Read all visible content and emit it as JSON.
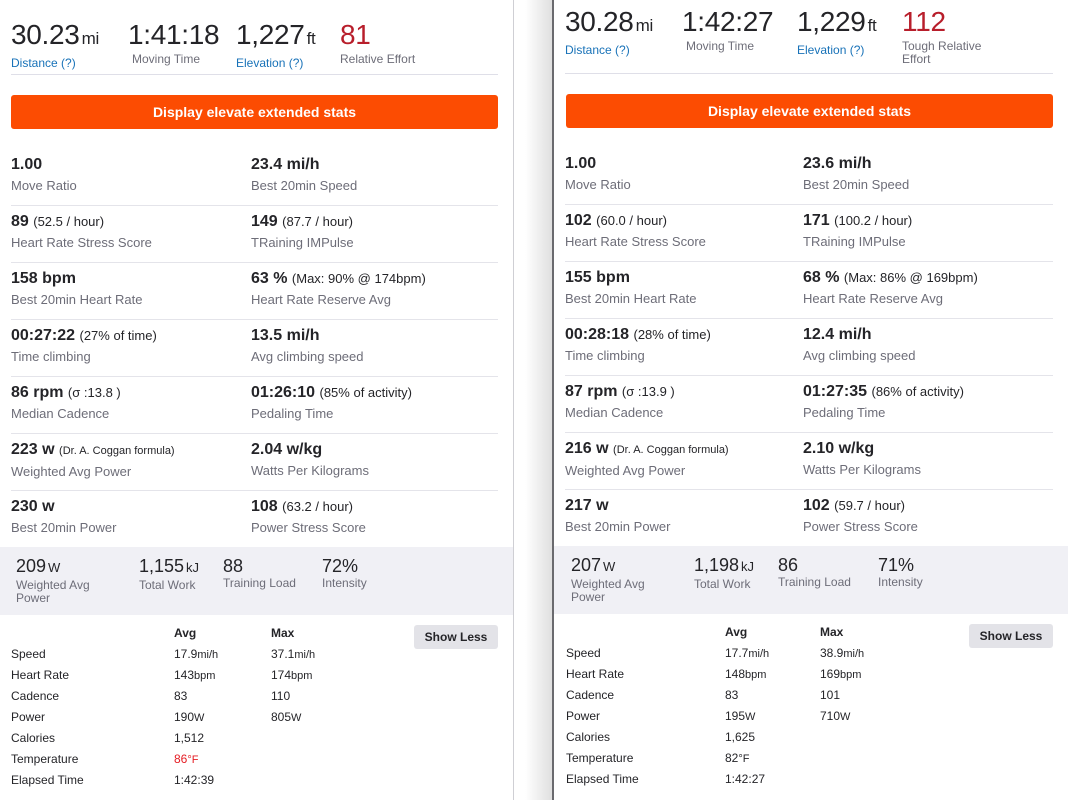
{
  "left": {
    "top_stats": [
      {
        "value": "30.23",
        "unit": "mi",
        "label": "Distance (?)",
        "link": true
      },
      {
        "value": "1:41:18",
        "unit": "",
        "label": "Moving Time",
        "link": false
      },
      {
        "value": "1,227",
        "unit": "ft",
        "label": "Elevation (?)",
        "link": true
      },
      {
        "value": "81",
        "unit": "",
        "label": "Relative Effort",
        "link": false
      }
    ],
    "elevate_button": "Display elevate extended stats",
    "grid": [
      [
        {
          "value": "1.00",
          "sub": "",
          "label": "Move Ratio"
        },
        {
          "value": "23.4 mi/h",
          "sub": "",
          "label": "Best 20min Speed"
        }
      ],
      [
        {
          "value": "89",
          "sub": "(52.5 / hour)",
          "label": "Heart Rate Stress Score"
        },
        {
          "value": "149",
          "sub": "(87.7 / hour)",
          "label": "TRaining IMPulse"
        }
      ],
      [
        {
          "value": "158 bpm",
          "sub": "",
          "label": "Best 20min Heart Rate"
        },
        {
          "value": "63 %",
          "sub": "(Max: 90% @ 174bpm)",
          "label": "Heart Rate Reserve Avg"
        }
      ],
      [
        {
          "value": "00:27:22",
          "sub": "(27% of time)",
          "label": "Time climbing"
        },
        {
          "value": "13.5 mi/h",
          "sub": "",
          "label": "Avg climbing speed"
        }
      ],
      [
        {
          "value": "86 rpm",
          "sub": "(σ :13.8 )",
          "label": "Median Cadence"
        },
        {
          "value": "01:26:10",
          "sub": "(85% of activity)",
          "label": "Pedaling Time"
        }
      ],
      [
        {
          "value": "223 w",
          "sub": "(Dr. A. Coggan formula)",
          "label": "Weighted Avg Power"
        },
        {
          "value": "2.04 w/kg",
          "sub": "",
          "label": "Watts Per Kilograms"
        }
      ],
      [
        {
          "value": "230 w",
          "sub": "",
          "label": "Best 20min Power"
        },
        {
          "value": "108",
          "sub": "(63.2 / hour)",
          "label": "Power Stress Score"
        }
      ]
    ],
    "power_band": [
      {
        "value": "209",
        "unit": "W",
        "label": "Weighted Avg Power"
      },
      {
        "value": "1,155",
        "unit": "kJ",
        "label": "Total Work"
      },
      {
        "value": "88",
        "unit": "",
        "label": "Training Load"
      },
      {
        "value": "72%",
        "unit": "",
        "label": "Intensity"
      }
    ],
    "show_less": "Show Less",
    "table": {
      "headers": {
        "avg": "Avg",
        "max": "Max"
      },
      "rows": [
        {
          "name": "Speed",
          "avg": "17.9",
          "avg_unit": "mi/h",
          "max": "37.1",
          "max_unit": "mi/h"
        },
        {
          "name": "Heart Rate",
          "avg": "143",
          "avg_unit": "bpm",
          "max": "174",
          "max_unit": "bpm"
        },
        {
          "name": "Cadence",
          "avg": "83",
          "avg_unit": "",
          "max": "110",
          "max_unit": ""
        },
        {
          "name": "Power",
          "avg": "190",
          "avg_unit": "W",
          "max": "805",
          "max_unit": "W"
        },
        {
          "name": "Calories",
          "avg": "1,512",
          "avg_unit": "",
          "max": "",
          "max_unit": ""
        },
        {
          "name": "Temperature",
          "avg": "86",
          "avg_unit": "°F",
          "max": "",
          "max_unit": ""
        },
        {
          "name": "Elapsed Time",
          "avg": "1:42:39",
          "avg_unit": "",
          "max": "",
          "max_unit": ""
        }
      ]
    }
  },
  "right": {
    "top_stats": [
      {
        "value": "30.28",
        "unit": "mi",
        "label": "Distance (?)",
        "link": true
      },
      {
        "value": "1:42:27",
        "unit": "",
        "label": "Moving Time",
        "link": false
      },
      {
        "value": "1,229",
        "unit": "ft",
        "label": "Elevation (?)",
        "link": true
      },
      {
        "value": "112",
        "unit": "",
        "label": "Tough Relative Effort",
        "link": false
      }
    ],
    "elevate_button": "Display elevate extended stats",
    "grid": [
      [
        {
          "value": "1.00",
          "sub": "",
          "label": "Move Ratio"
        },
        {
          "value": "23.6 mi/h",
          "sub": "",
          "label": "Best 20min Speed"
        }
      ],
      [
        {
          "value": "102",
          "sub": "(60.0 / hour)",
          "label": "Heart Rate Stress Score"
        },
        {
          "value": "171",
          "sub": "(100.2 / hour)",
          "label": "TRaining IMPulse"
        }
      ],
      [
        {
          "value": "155 bpm",
          "sub": "",
          "label": "Best 20min Heart Rate"
        },
        {
          "value": "68 %",
          "sub": "(Max: 86% @ 169bpm)",
          "label": "Heart Rate Reserve Avg"
        }
      ],
      [
        {
          "value": "00:28:18",
          "sub": "(28% of time)",
          "label": "Time climbing"
        },
        {
          "value": "12.4 mi/h",
          "sub": "",
          "label": "Avg climbing speed"
        }
      ],
      [
        {
          "value": "87 rpm",
          "sub": "(σ :13.9 )",
          "label": "Median Cadence"
        },
        {
          "value": "01:27:35",
          "sub": "(86% of activity)",
          "label": "Pedaling Time"
        }
      ],
      [
        {
          "value": "216 w",
          "sub": "(Dr. A. Coggan formula)",
          "label": "Weighted Avg Power"
        },
        {
          "value": "2.10 w/kg",
          "sub": "",
          "label": "Watts Per Kilograms"
        }
      ],
      [
        {
          "value": "217 w",
          "sub": "",
          "label": "Best 20min Power"
        },
        {
          "value": "102",
          "sub": "(59.7 / hour)",
          "label": "Power Stress Score"
        }
      ]
    ],
    "power_band": [
      {
        "value": "207",
        "unit": "W",
        "label": "Weighted Avg Power"
      },
      {
        "value": "1,198",
        "unit": "kJ",
        "label": "Total Work"
      },
      {
        "value": "86",
        "unit": "",
        "label": "Training Load"
      },
      {
        "value": "71%",
        "unit": "",
        "label": "Intensity"
      }
    ],
    "show_less": "Show Less",
    "table": {
      "headers": {
        "avg": "Avg",
        "max": "Max"
      },
      "rows": [
        {
          "name": "Speed",
          "avg": "17.7",
          "avg_unit": "mi/h",
          "max": "38.9",
          "max_unit": "mi/h"
        },
        {
          "name": "Heart Rate",
          "avg": "148",
          "avg_unit": "bpm",
          "max": "169",
          "max_unit": "bpm"
        },
        {
          "name": "Cadence",
          "avg": "83",
          "avg_unit": "",
          "max": "101",
          "max_unit": ""
        },
        {
          "name": "Power",
          "avg": "195",
          "avg_unit": "W",
          "max": "710",
          "max_unit": "W"
        },
        {
          "name": "Calories",
          "avg": "1,625",
          "avg_unit": "",
          "max": "",
          "max_unit": ""
        },
        {
          "name": "Temperature",
          "avg": "82",
          "avg_unit": "°F",
          "max": "",
          "max_unit": ""
        },
        {
          "name": "Elapsed Time",
          "avg": "1:42:27",
          "avg_unit": "",
          "max": "",
          "max_unit": ""
        }
      ]
    }
  },
  "colors": {
    "elevate_orange": "#fc4c02",
    "effort_red": "#b81e2b",
    "link_blue": "#1872b8",
    "hot_temp": "#e51c23"
  }
}
